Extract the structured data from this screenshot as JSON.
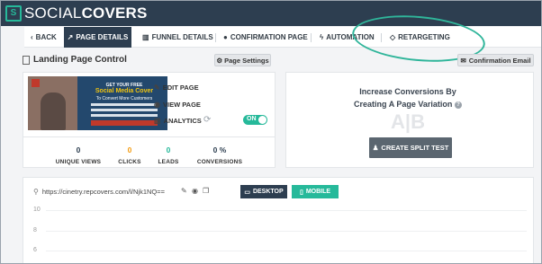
{
  "brand": {
    "name_light": "SOCIAL",
    "name_bold": "COVERS",
    "badge": "S"
  },
  "nav": {
    "back": "BACK",
    "page_details": "PAGE DETAILS",
    "funnel_details": "FUNNEL DETAILS",
    "confirmation_page": "CONFIRMATION PAGE",
    "automation": "AUTOMATION",
    "retargeting": "RETARGETING",
    "active_tab": "PAGE DETAILS"
  },
  "left_panel": {
    "title": "Landing Page Control",
    "page_settings": "Page Settings",
    "thumbnail": {
      "line1": "GET YOUR FREE",
      "line2": "Social Media Cover",
      "line3": "To Convert More Customers",
      "button": "GIVE ME MY FREE SOCIAL COVER!"
    },
    "actions": {
      "edit": "EDIT PAGE",
      "view": "VIEW PAGE",
      "analytics": "ANALYTICS"
    },
    "toggle": {
      "label": "ON",
      "state": true
    },
    "stats": [
      {
        "value": "0",
        "label": "UNIQUE VIEWS",
        "color": "#2d3e50"
      },
      {
        "value": "0",
        "label": "CLICKS",
        "color": "#f39c12"
      },
      {
        "value": "0",
        "label": "LEADS",
        "color": "#26b99a"
      },
      {
        "value": "0 %",
        "label": "CONVERSIONS",
        "color": "#2d3e50"
      }
    ]
  },
  "right_panel": {
    "confirmation_email": "Confirmation Email",
    "heading_line1": "Increase Conversions By",
    "heading_line2": "Creating A Page Variation",
    "help_icon": "?",
    "ab_text": "A|B",
    "split_test_button": "CREATE SPLIT TEST"
  },
  "bottom_panel": {
    "url": "https://cinetry.repcovers.com/l/Njk1NQ==",
    "desktop": "DESKTOP",
    "mobile": "MOBILE",
    "y_ticks": [
      "10",
      "8",
      "6"
    ]
  },
  "colors": {
    "nav_dark": "#2d3e50",
    "accent_green": "#26b99a",
    "clicks_orange": "#f39c12",
    "split_button": "#5b6670"
  }
}
